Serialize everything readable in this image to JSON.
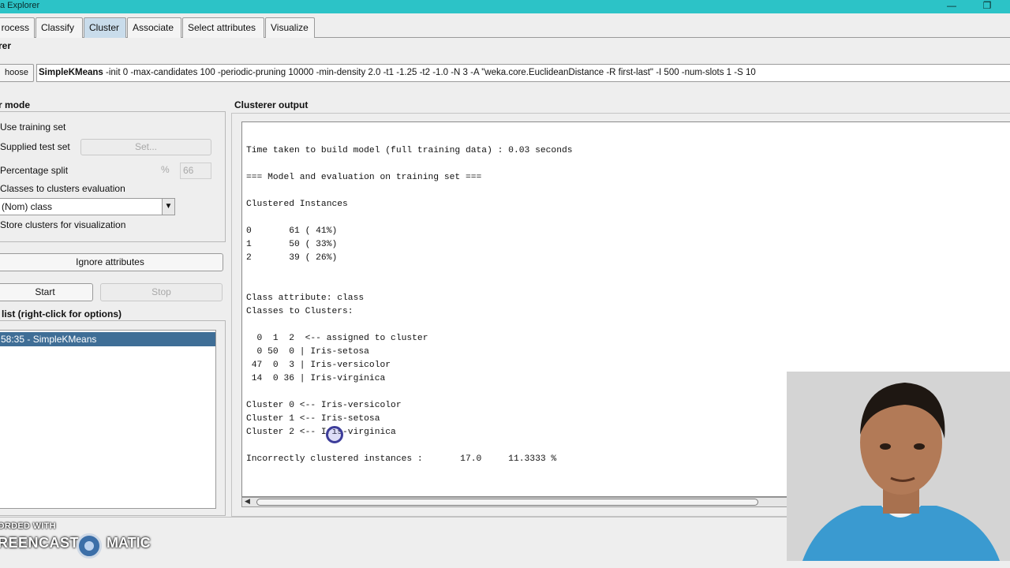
{
  "window": {
    "title": "a Explorer"
  },
  "tabs": [
    {
      "label": "rocess"
    },
    {
      "label": "Classify"
    },
    {
      "label": "Cluster"
    },
    {
      "label": "Associate"
    },
    {
      "label": "Select attributes"
    },
    {
      "label": "Visualize"
    }
  ],
  "clusterer": {
    "header": "rer",
    "choose_label": "hoose",
    "name": "SimpleKMeans",
    "options": " -init 0 -max-candidates 100 -periodic-pruning 10000 -min-density 2.0 -t1 -1.25 -t2 -1.0 -N 3 -A \"weka.core.EuclideanDistance -R first-last\" -I 500 -num-slots 1 -S 10"
  },
  "cluster_mode": {
    "header": "r mode",
    "use_training": "Use training set",
    "supplied_test": "Supplied test set",
    "set_button": "Set...",
    "percentage_split": "Percentage split",
    "pct_symbol": "%",
    "pct_value": "66",
    "classes_to_clusters": "Classes to clusters evaluation",
    "class_select": "(Nom) class",
    "store_clusters": "Store clusters for visualization"
  },
  "buttons": {
    "ignore_attributes": "Ignore attributes",
    "start": "Start",
    "stop": "Stop"
  },
  "result_list": {
    "header": "list (right-click for options)",
    "items": [
      "58:35 - SimpleKMeans"
    ]
  },
  "output": {
    "header": "Clusterer output",
    "text": "Time taken to build model (full training data) : 0.03 seconds\n\n=== Model and evaluation on training set ===\n\nClustered Instances\n\n0       61 ( 41%)\n1       50 ( 33%)\n2       39 ( 26%)\n\n\nClass attribute: class\nClasses to Clusters:\n\n  0  1  2  <-- assigned to cluster\n  0 50  0 | Iris-setosa\n 47  0  3 | Iris-versicolor\n 14  0 36 | Iris-virginica\n\nCluster 0 <-- Iris-versicolor\nCluster 1 <-- Iris-setosa\nCluster 2 <-- Iris-virginica\n\nIncorrectly clustered instances :       17.0     11.3333 %"
  },
  "watermark": {
    "line1": "ORDED WITH",
    "line2": "REENCAST",
    "line3": "MATIC"
  },
  "colors": {
    "titlebar": "#2cc3c7",
    "active_tab": "#c9dceb",
    "selection": "#3f6e96"
  }
}
